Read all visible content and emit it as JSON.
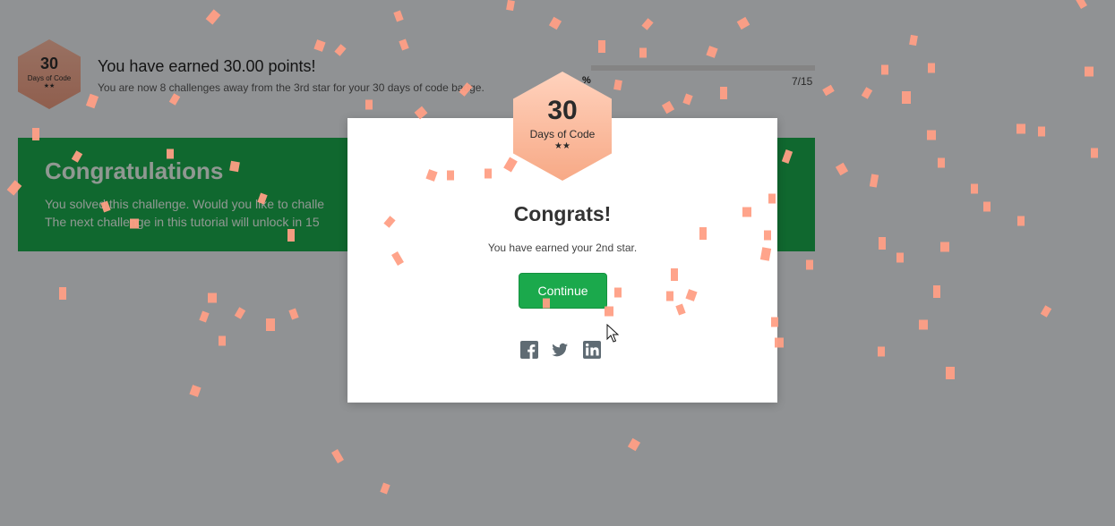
{
  "points_header": {
    "badge_number": "30",
    "badge_label": "Days of Code",
    "badge_stars": "★★",
    "title": "You have earned 30.00 points!",
    "subtitle": "You are now 8 challenges away from the 3rd star for your 30 days of code badge.",
    "progress_percent_label": "%",
    "progress_count": "7/15"
  },
  "banner": {
    "title": "Congratulations",
    "line1": "You solved this challenge. Would you like to challe",
    "line2": "The next challenge in this tutorial will unlock in 15"
  },
  "modal": {
    "badge_number": "30",
    "badge_label": "Days of Code",
    "badge_stars": "★★",
    "heading": "Congrats!",
    "message": "You have earned your 2nd star.",
    "continue_label": "Continue"
  },
  "social": [
    "facebook-icon",
    "twitter-icon",
    "linkedin-icon"
  ],
  "colors": {
    "accent_green": "#1ba94c",
    "badge_orange": "#f7a986",
    "confetti": "#ff9f85"
  }
}
